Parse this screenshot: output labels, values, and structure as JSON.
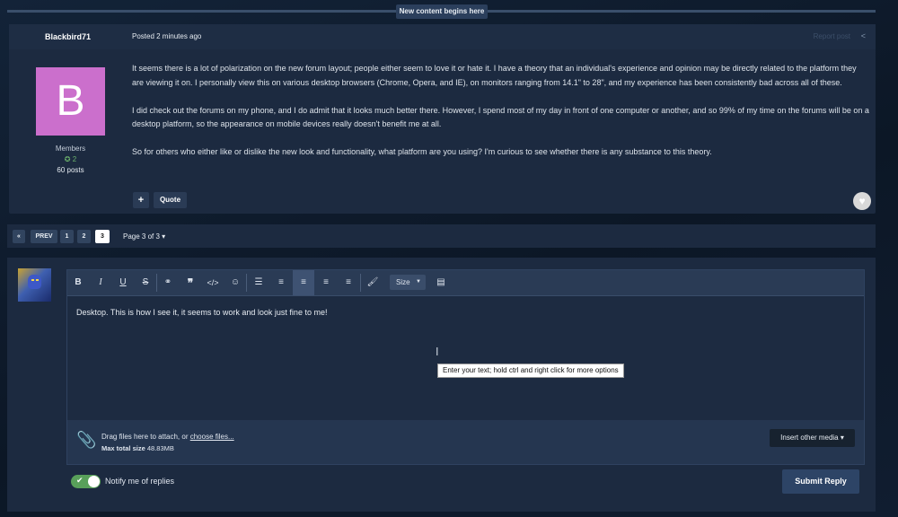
{
  "new_content_badge": "New content begins here",
  "post": {
    "author": "Blackbird71",
    "posted": "Posted 2 minutes ago",
    "report": "Report post",
    "share_icon": "share-icon",
    "avatar_letter": "B",
    "avatar_color": "#cb6fcc",
    "role": "Members",
    "reputation": "2",
    "post_count": "60 posts",
    "paragraphs": [
      "It seems there is a lot of polarization on the new forum layout; people either seem to love it or hate it.  I have a theory that an individual's experience and opinion may be directly related to the platform they are viewing it on.  I personally view this on various desktop browsers (Chrome, Opera, and IE), on monitors ranging from 14.1\" to 28\", and my experience has been consistently bad across all of these.",
      "I did check out the forums on my phone, and I do admit that it looks much better there.  However, I spend most of my day in front of one computer or another, and so 99% of my time on the forums will be on a desktop platform, so the appearance on mobile devices really doesn't benefit me at all.",
      "So for others who either like or dislike the new look and functionality, what platform are you using?  I'm curious to see whether there is any substance to this theory."
    ],
    "plus_label": "+",
    "quote_label": "Quote"
  },
  "pagination": {
    "first": "«",
    "prev": "PREV",
    "pages": [
      "1",
      "2",
      "3"
    ],
    "active_page": "3",
    "page_of": "Page 3 of 3 ▾"
  },
  "editor": {
    "toolbar": [
      "B",
      "I",
      "U",
      "S",
      "link-icon",
      "quote-icon",
      "code-icon",
      "emoji-icon",
      "bullet-list-icon",
      "numbered-list-icon",
      "align-left-icon",
      "align-center-icon",
      "align-right-icon",
      "brush-icon",
      "source-icon"
    ],
    "size_label": "Size",
    "content": "Desktop. This is how I see it, it seems to work and look just fine to me!",
    "tooltip": "Enter your text; hold ctrl and right click for more options",
    "attach_text": "Drag files here to attach, or ",
    "choose_files": "choose files...",
    "max_total_label": "Max total size",
    "max_total_value": "48.83MB",
    "insert_media": "Insert other media ▾"
  },
  "notify_label": "Notify me of replies",
  "submit_label": "Submit Reply",
  "accent": "#58a05a"
}
